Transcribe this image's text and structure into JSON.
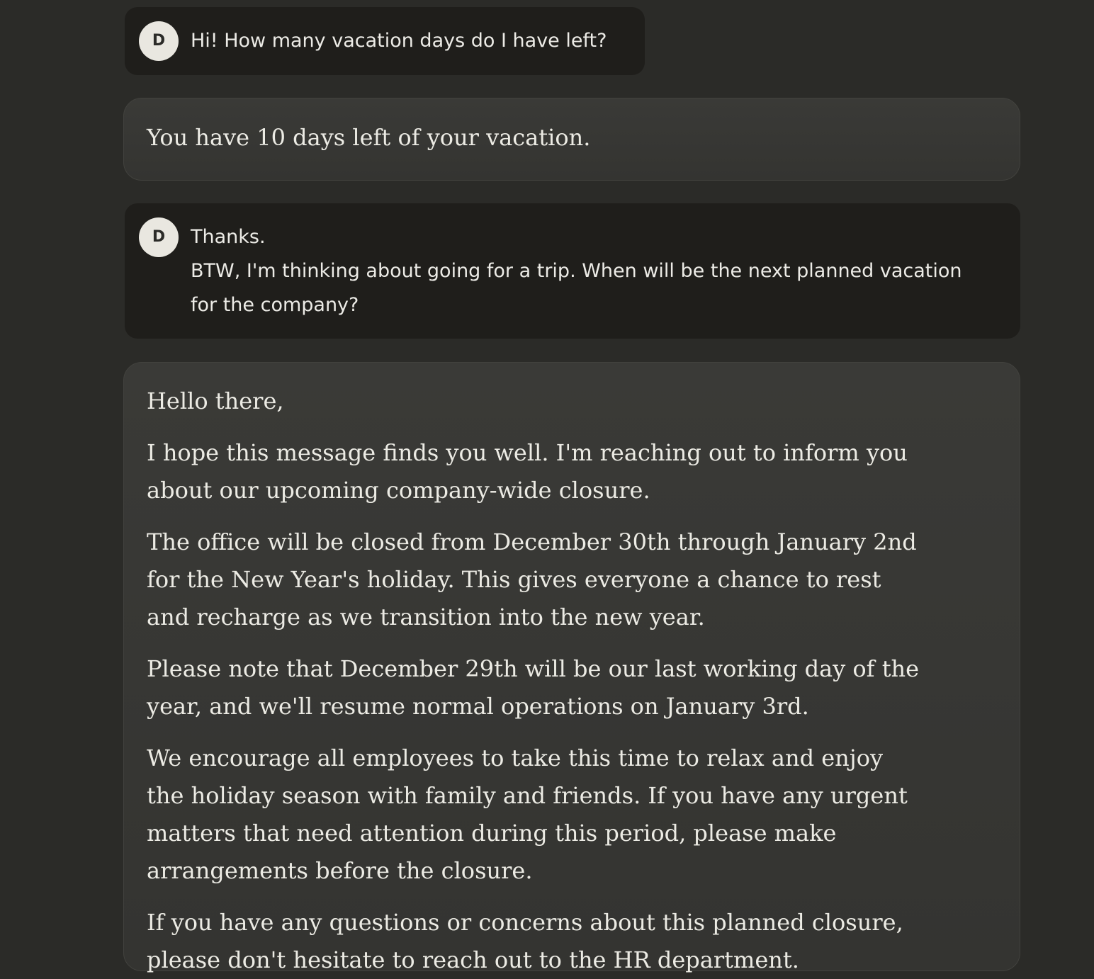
{
  "conversation": {
    "user_message_1": {
      "avatar_initial": "D",
      "text": "Hi! How many vacation days do I have left?"
    },
    "assistant_message_1": {
      "text": "You have 10 days left of your vacation."
    },
    "user_message_2": {
      "avatar_initial": "D",
      "lines": [
        "Thanks.",
        "BTW, I'm thinking about going for a trip. When will be the next planned vacation for the company?"
      ]
    },
    "assistant_message_2": {
      "paragraphs": [
        "Hello there,",
        "I hope this message finds you well. I'm reaching out to inform you about our upcoming company-wide closure.",
        "The office will be closed from December 30th through January 2nd for the New Year's holiday. This gives everyone a chance to rest and recharge as we transition into the new year.",
        "Please note that December 29th will be our last working day of the year, and we'll resume normal operations on January 3rd.",
        "We encourage all employees to take this time to relax and enjoy the holiday season with family and friends. If you have any urgent matters that need attention during this period, please make arrangements before the closure.",
        "If you have any questions or concerns about this planned closure, please don't hesitate to reach out to the HR department."
      ]
    }
  }
}
